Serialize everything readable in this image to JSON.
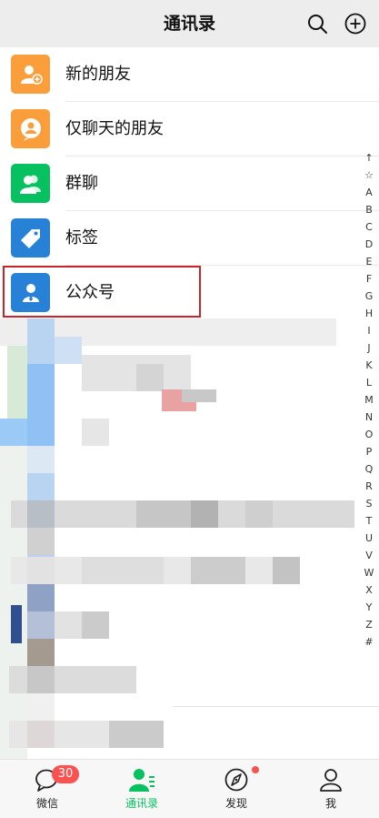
{
  "header": {
    "title": "通讯录"
  },
  "list": [
    {
      "label": "新的朋友",
      "icon": "add-friend-icon",
      "color": "#fa9d3b"
    },
    {
      "label": "仅聊天的朋友",
      "icon": "chat-only-friend-icon",
      "color": "#fa9d3b"
    },
    {
      "label": "群聊",
      "icon": "group-chat-icon",
      "color": "#07c160"
    },
    {
      "label": "标签",
      "icon": "tag-icon",
      "color": "#2782d7"
    },
    {
      "label": "公众号",
      "icon": "official-account-icon",
      "color": "#2782d7"
    }
  ],
  "index_bar": [
    "↑",
    "☆",
    "A",
    "B",
    "C",
    "D",
    "E",
    "F",
    "G",
    "H",
    "I",
    "J",
    "K",
    "L",
    "M",
    "N",
    "O",
    "P",
    "Q",
    "R",
    "S",
    "T",
    "U",
    "V",
    "W",
    "X",
    "Y",
    "Z",
    "#"
  ],
  "tabs": [
    {
      "label": "微信",
      "icon": "chat-bubble-icon",
      "badge": "30"
    },
    {
      "label": "通讯录",
      "icon": "contacts-icon",
      "active": true
    },
    {
      "label": "发现",
      "icon": "compass-icon",
      "dot": true
    },
    {
      "label": "我",
      "icon": "person-icon"
    }
  ],
  "colors": {
    "accent": "#07c160",
    "badge": "#fa5151",
    "highlight_border": "#c8242b"
  }
}
